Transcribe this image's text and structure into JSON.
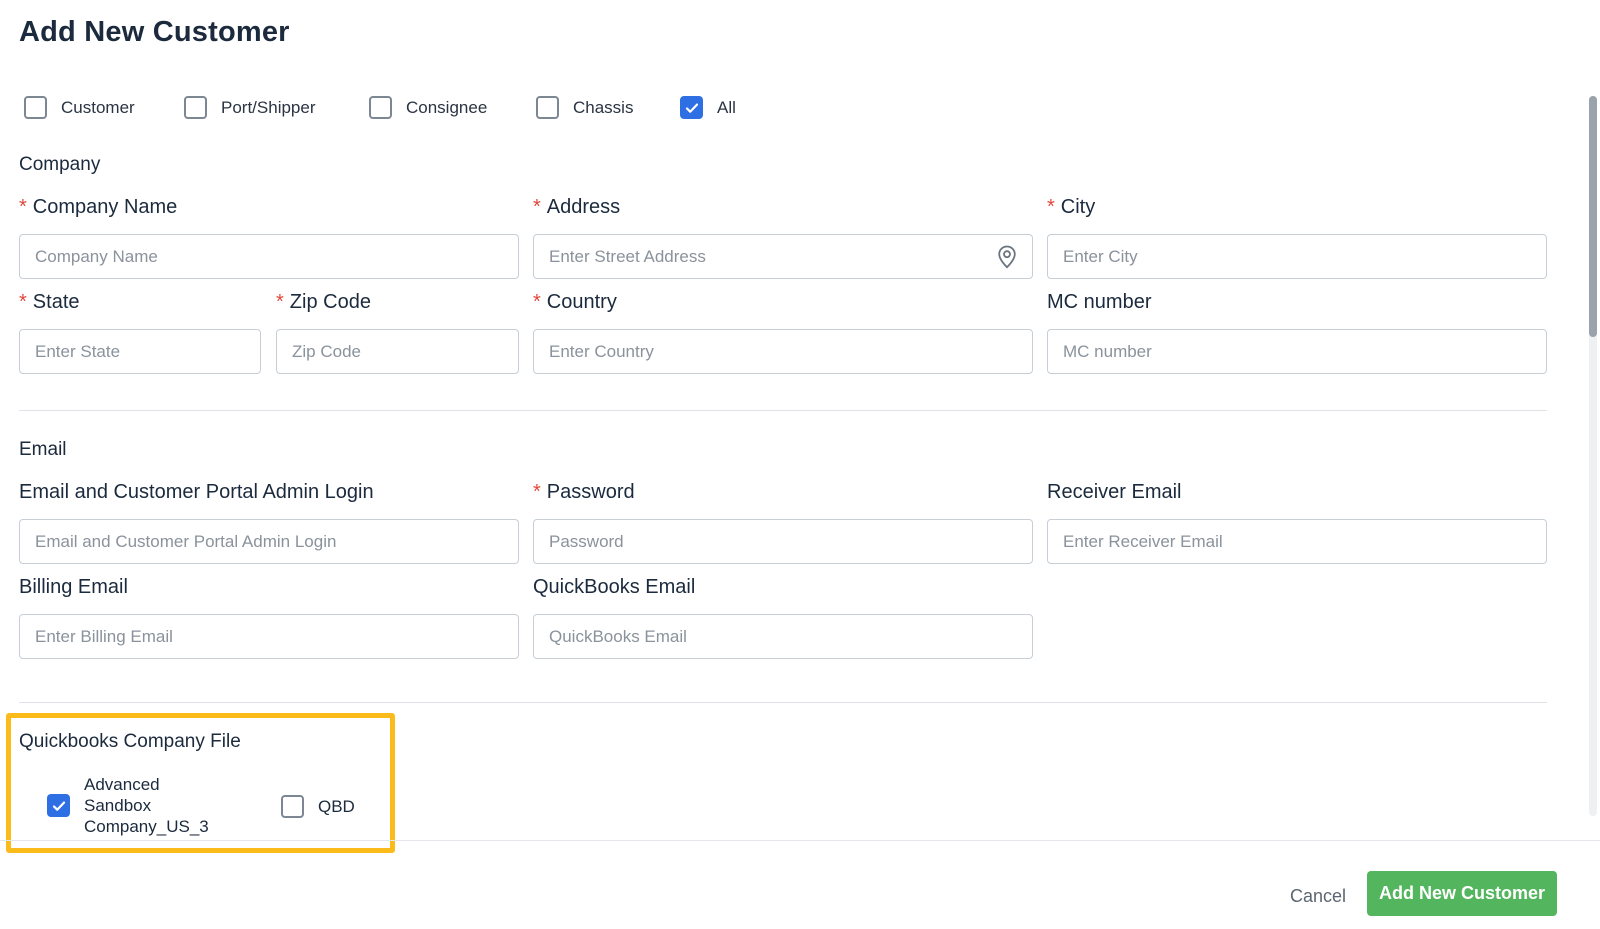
{
  "title": "Add New Customer",
  "customer_types": [
    {
      "label": "Customer",
      "checked": false
    },
    {
      "label": "Port/Shipper",
      "checked": false
    },
    {
      "label": "Consignee",
      "checked": false
    },
    {
      "label": "Chassis",
      "checked": false
    },
    {
      "label": "All",
      "checked": true
    }
  ],
  "company_section": {
    "title": "Company",
    "company_name": {
      "label": "Company Name",
      "required": "*",
      "placeholder": "Company Name",
      "value": ""
    },
    "address": {
      "label": "Address",
      "required": "*",
      "placeholder": "Enter Street Address",
      "value": "",
      "icon": "location-pin-icon"
    },
    "city": {
      "label": "City",
      "required": "*",
      "placeholder": "Enter City",
      "value": ""
    },
    "state": {
      "label": "State",
      "required": "*",
      "placeholder": "Enter State",
      "value": ""
    },
    "zip": {
      "label": "Zip Code",
      "required": "*",
      "placeholder": "Zip Code",
      "value": ""
    },
    "country": {
      "label": "Country",
      "required": "*",
      "placeholder": "Enter Country",
      "value": ""
    },
    "mc_number": {
      "label": "MC number",
      "placeholder": "MC number",
      "value": ""
    }
  },
  "email_section": {
    "title": "Email",
    "portal_login": {
      "label": "Email and Customer Portal Admin Login",
      "placeholder": "Email and Customer Portal Admin Login",
      "value": ""
    },
    "password": {
      "label": "Password",
      "required": "*",
      "placeholder": "Password",
      "value": ""
    },
    "receiver_email": {
      "label": "Receiver Email",
      "placeholder": "Enter Receiver Email",
      "value": ""
    },
    "billing_email": {
      "label": "Billing Email",
      "placeholder": "Enter Billing Email",
      "value": ""
    },
    "quickbooks_email": {
      "label": "QuickBooks Email",
      "placeholder": "QuickBooks Email",
      "value": ""
    }
  },
  "quickbooks_section": {
    "title": "Quickbooks Company File",
    "options": [
      {
        "label_lines": [
          "Advanced",
          "Sandbox",
          "Company_US_3"
        ],
        "checked": true
      },
      {
        "label_lines": [
          "QBD"
        ],
        "checked": false
      }
    ],
    "highlight_color": "#fbbb1a"
  },
  "footer": {
    "cancel_label": "Cancel",
    "submit_label": "Add New Customer",
    "submit_color": "#53b55d"
  },
  "colors": {
    "accent": "#2f6fe4",
    "required": "#e0463a"
  }
}
